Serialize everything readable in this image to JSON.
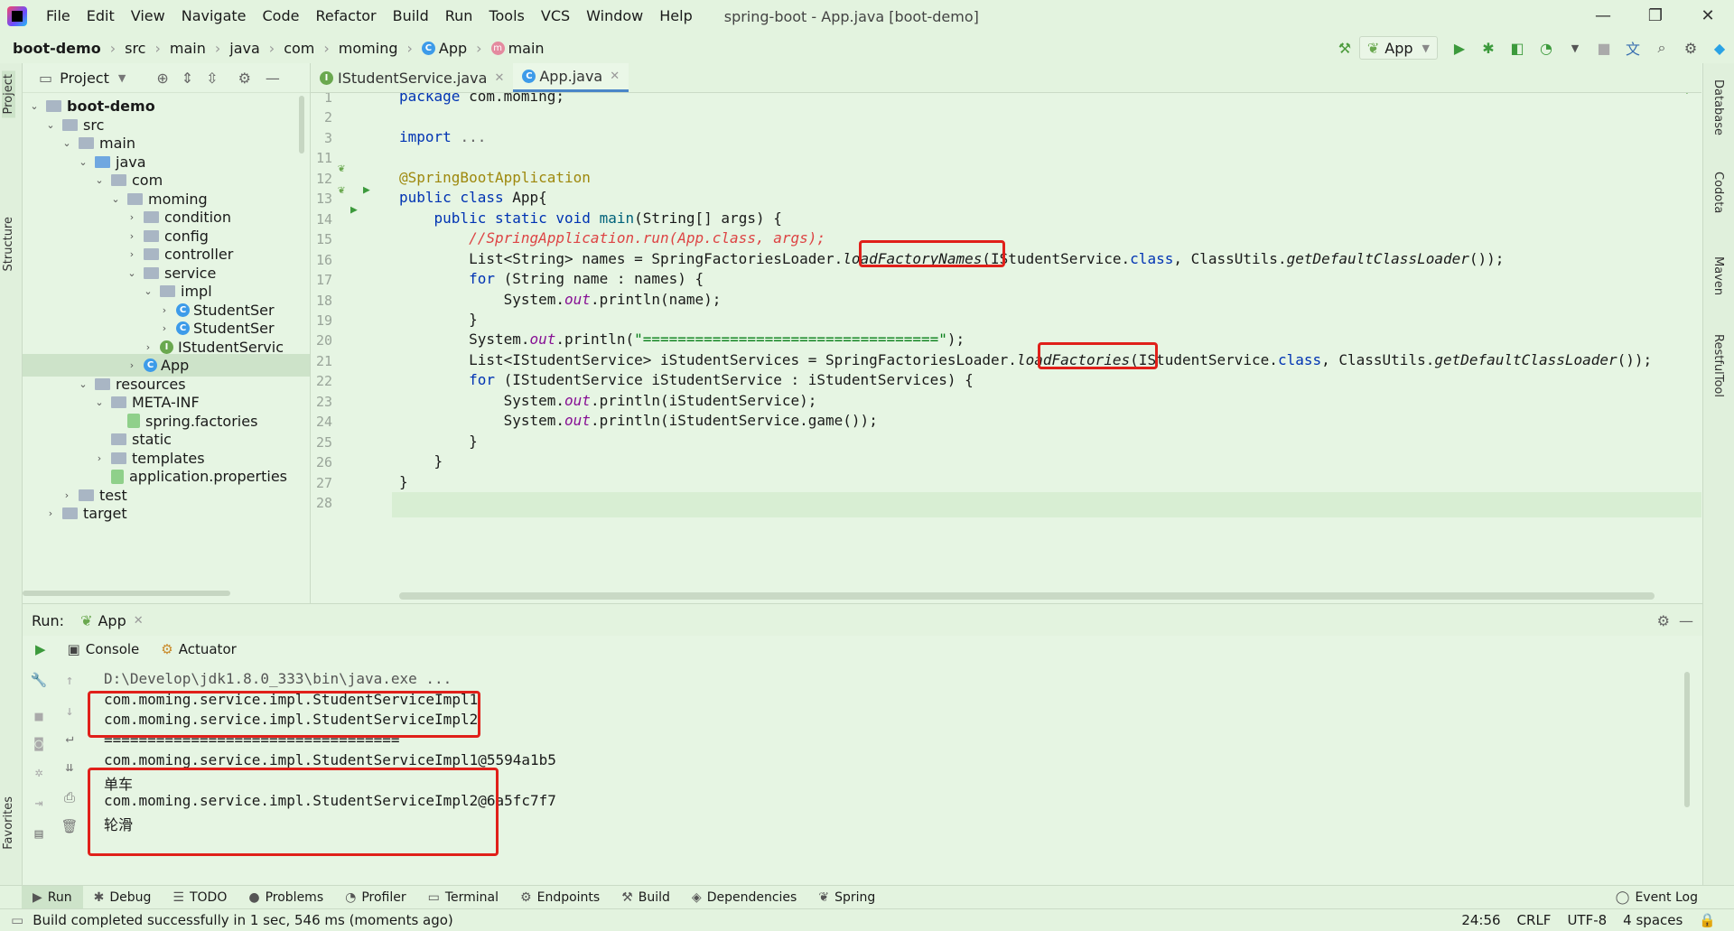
{
  "window": {
    "title": "spring-boot - App.java [boot-demo]",
    "menu": [
      "File",
      "Edit",
      "View",
      "Navigate",
      "Code",
      "Refactor",
      "Build",
      "Run",
      "Tools",
      "VCS",
      "Window",
      "Help"
    ],
    "controls": [
      "—",
      "❐",
      "✕"
    ]
  },
  "breadcrumb": [
    "boot-demo",
    "src",
    "main",
    "java",
    "com",
    "moming",
    "App",
    "main"
  ],
  "run_config": "App",
  "left_tabs": [
    "Project",
    "Structure",
    "Favorites"
  ],
  "right_tabs": [
    "Database",
    "Codota",
    "Maven",
    "RestfulTool"
  ],
  "project": {
    "header": "Project",
    "tree": [
      {
        "label": "boot-demo",
        "depth": 0,
        "type": "module",
        "arrow": "⌄",
        "bold": true
      },
      {
        "label": "src",
        "depth": 1,
        "type": "folder",
        "arrow": "⌄"
      },
      {
        "label": "main",
        "depth": 2,
        "type": "folder",
        "arrow": "⌄"
      },
      {
        "label": "java",
        "depth": 3,
        "type": "folder-blue",
        "arrow": "⌄"
      },
      {
        "label": "com",
        "depth": 4,
        "type": "folder",
        "arrow": "⌄"
      },
      {
        "label": "moming",
        "depth": 5,
        "type": "folder",
        "arrow": "⌄"
      },
      {
        "label": "condition",
        "depth": 6,
        "type": "folder",
        "arrow": "›"
      },
      {
        "label": "config",
        "depth": 6,
        "type": "folder",
        "arrow": "›"
      },
      {
        "label": "controller",
        "depth": 6,
        "type": "folder",
        "arrow": "›"
      },
      {
        "label": "service",
        "depth": 6,
        "type": "folder",
        "arrow": "⌄"
      },
      {
        "label": "impl",
        "depth": 7,
        "type": "folder",
        "arrow": "⌄"
      },
      {
        "label": "StudentSer",
        "depth": 8,
        "type": "class",
        "arrow": "›"
      },
      {
        "label": "StudentSer",
        "depth": 8,
        "type": "class",
        "arrow": "›"
      },
      {
        "label": "IStudentServic",
        "depth": 7,
        "type": "interface",
        "arrow": "›"
      },
      {
        "label": "App",
        "depth": 6,
        "type": "class",
        "arrow": "›",
        "selected": true
      },
      {
        "label": "resources",
        "depth": 3,
        "type": "folder",
        "arrow": "⌄"
      },
      {
        "label": "META-INF",
        "depth": 4,
        "type": "folder",
        "arrow": "⌄"
      },
      {
        "label": "spring.factories",
        "depth": 5,
        "type": "file",
        "arrow": ""
      },
      {
        "label": "static",
        "depth": 4,
        "type": "folder",
        "arrow": ""
      },
      {
        "label": "templates",
        "depth": 4,
        "type": "folder",
        "arrow": "›"
      },
      {
        "label": "application.properties",
        "depth": 4,
        "type": "file",
        "arrow": ""
      },
      {
        "label": "test",
        "depth": 2,
        "type": "folder",
        "arrow": "›"
      },
      {
        "label": "target",
        "depth": 1,
        "type": "folder",
        "arrow": "›"
      }
    ]
  },
  "editor_tabs": [
    {
      "label": "IStudentService.java",
      "icon": "I",
      "active": false
    },
    {
      "label": "App.java",
      "icon": "C",
      "active": true
    }
  ],
  "code_lines": [
    {
      "n": "1",
      "html": "<span class=\"kw\">package</span> com.moming;"
    },
    {
      "n": "2",
      "html": ""
    },
    {
      "n": "3",
      "html": "<span class=\"kw\">import</span> <span style=\"color:#666\">...</span>"
    },
    {
      "n": "11",
      "html": ""
    },
    {
      "n": "12",
      "html": "<span class=\"an\">@SpringBootApplication</span>"
    },
    {
      "n": "13",
      "html": "<span class=\"kw\">public class</span> App{"
    },
    {
      "n": "14",
      "html": "    <span class=\"kw\">public static void</span> <span style=\"color:#00627a\">main</span>(String[] args) {"
    },
    {
      "n": "15",
      "html": "        <span class=\"cm\">//SpringApplication.run(App.class, args);</span>"
    },
    {
      "n": "16",
      "html": "        List&lt;String&gt; names = SpringFactoriesLoader.<span class=\"it\">loadFactoryNames</span>(IStudentService.<span class=\"kw\">class</span>, ClassUtils.<span class=\"it\">getDefaultClassLoader</span>());"
    },
    {
      "n": "17",
      "html": "        <span class=\"kw\">for</span> (String name : names) {"
    },
    {
      "n": "18",
      "html": "            System.<span class=\"fld\">out</span>.println(name);"
    },
    {
      "n": "19",
      "html": "        }"
    },
    {
      "n": "20",
      "html": "        System.<span class=\"fld\">out</span>.println(<span class=\"st\">\"==================================\"</span>);"
    },
    {
      "n": "21",
      "html": "        List&lt;IStudentService&gt; iStudentServices = SpringFactoriesLoader.<span class=\"it\">loadFactories</span>(IStudentService.<span class=\"kw\">class</span>, ClassUtils.<span class=\"it\">getDefaultClassLoader</span>());"
    },
    {
      "n": "22",
      "html": "        <span class=\"kw\">for</span> (IStudentService iStudentService : iStudentServices) {"
    },
    {
      "n": "23",
      "html": "            System.<span class=\"fld\">out</span>.println(iStudentService);"
    },
    {
      "n": "24",
      "html": "            System.<span class=\"fld\">out</span>.println(iStudentService.game());"
    },
    {
      "n": "25",
      "html": "        }"
    },
    {
      "n": "26",
      "html": "    }"
    },
    {
      "n": "27",
      "html": "}"
    },
    {
      "n": "28",
      "html": ""
    }
  ],
  "run_panel": {
    "label": "Run:",
    "tab": "App",
    "subtabs": [
      "Console",
      "Actuator"
    ],
    "console_lines": [
      "D:\\Develop\\jdk1.8.0_333\\bin\\java.exe ...",
      "com.moming.service.impl.StudentServiceImpl1",
      "com.moming.service.impl.StudentServiceImpl2",
      "==================================",
      "com.moming.service.impl.StudentServiceImpl1@5594a1b5",
      "单车",
      "com.moming.service.impl.StudentServiceImpl2@6a5fc7f7",
      "轮滑"
    ]
  },
  "bottom_tabs": [
    {
      "label": "Run",
      "icon": "▶"
    },
    {
      "label": "Debug",
      "icon": "✱"
    },
    {
      "label": "TODO",
      "icon": "☰"
    },
    {
      "label": "Problems",
      "icon": "●"
    },
    {
      "label": "Profiler",
      "icon": "◔"
    },
    {
      "label": "Terminal",
      "icon": "▭"
    },
    {
      "label": "Endpoints",
      "icon": "⚙"
    },
    {
      "label": "Build",
      "icon": "⚒"
    },
    {
      "label": "Dependencies",
      "icon": "◈"
    },
    {
      "label": "Spring",
      "icon": "❦"
    }
  ],
  "event_log": "Event Log",
  "status": {
    "message": "Build completed successfully in 1 sec, 546 ms (moments ago)",
    "position": "24:56",
    "line_sep": "CRLF",
    "encoding": "UTF-8",
    "indent": "4 spaces"
  },
  "colors": {
    "accent": "#e0201a",
    "background": "#e6f5e3"
  }
}
